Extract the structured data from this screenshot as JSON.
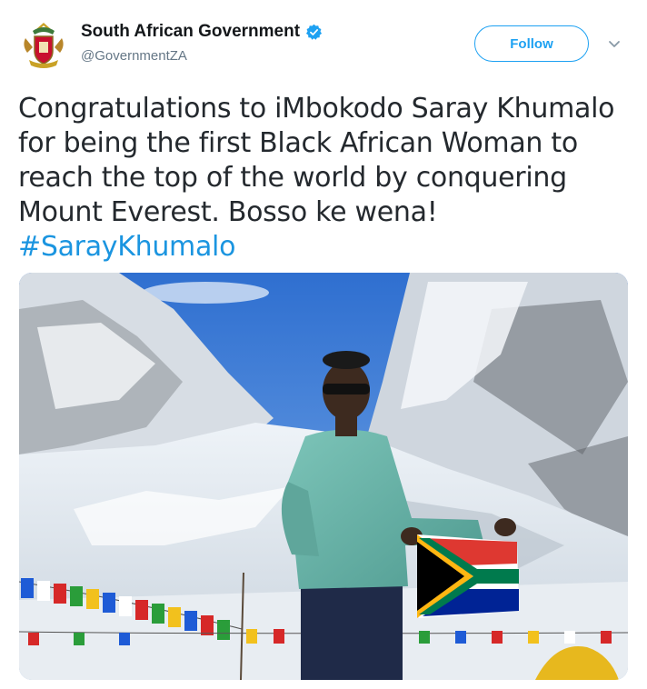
{
  "author": {
    "display_name": "South African Government",
    "handle": "@GovernmentZA",
    "verified": true
  },
  "follow_button": {
    "label": "Follow"
  },
  "tweet": {
    "lines": [
      "Congratulations to iMbokodo Saray Khumalo",
      "for being the first Black African Woman to",
      "reach the top of the world by conquering",
      "Mount Everest.  Bosso ke wena!"
    ],
    "hashtag": "#SarayKhumalo"
  },
  "colors": {
    "brand_blue": "#1da1f2",
    "hashtag_blue": "#1b95e0",
    "handle_gray": "#657786"
  },
  "icons": {
    "avatar": "coat-of-arms-icon",
    "verified": "verified-badge-icon",
    "more": "chevron-down-icon"
  }
}
